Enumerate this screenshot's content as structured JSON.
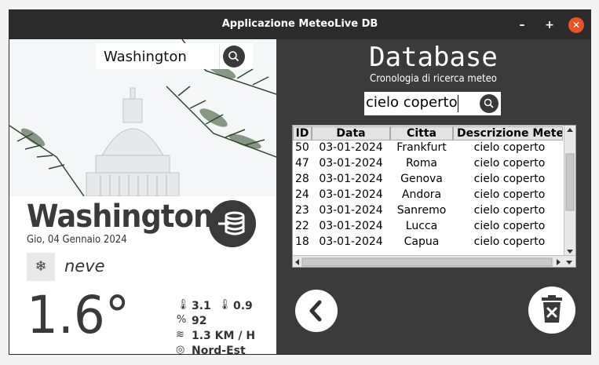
{
  "window": {
    "title": "Applicazione MeteoLive DB",
    "controls": [
      "minimize-icon",
      "maximize-icon",
      "close-icon"
    ]
  },
  "left_panel": {
    "search": {
      "value": "Washington",
      "button_icon": "search-icon"
    },
    "city": "Washington",
    "date": "Gio, 04 Gennaio 2024",
    "db_button_icon": "database-import-icon",
    "condition": {
      "icon": "snowflake-icon",
      "text": "neve"
    },
    "temperature": "1.6°",
    "stats": {
      "temp_max": "3.1",
      "temp_min": "0.9",
      "humidity": "92",
      "wind": "1.3 KM / H",
      "direction": "Nord-Est"
    }
  },
  "right_panel": {
    "title": "Database",
    "subtitle": "Cronologia di ricerca meteo",
    "filter": {
      "value": "cielo coperto",
      "button_icon": "search-icon"
    },
    "table": {
      "columns": [
        "ID",
        "Data",
        "Citta",
        "Descrizione Meteo"
      ],
      "rows": [
        [
          "50",
          "03-01-2024",
          "Frankfurt",
          "cielo coperto"
        ],
        [
          "47",
          "03-01-2024",
          "Roma",
          "cielo coperto"
        ],
        [
          "28",
          "03-01-2024",
          "Genova",
          "cielo coperto"
        ],
        [
          "24",
          "03-01-2024",
          "Andora",
          "cielo coperto"
        ],
        [
          "23",
          "03-01-2024",
          "Sanremo",
          "cielo coperto"
        ],
        [
          "22",
          "03-01-2024",
          "Lucca",
          "cielo coperto"
        ],
        [
          "18",
          "03-01-2024",
          "Capua",
          "cielo coperto"
        ]
      ]
    },
    "back_icon": "chevron-left-icon",
    "delete_icon": "trash-icon"
  },
  "colors": {
    "panel_dark": "#3b3b3b",
    "close_accent": "#e95420",
    "title_text": "#ffffff"
  }
}
